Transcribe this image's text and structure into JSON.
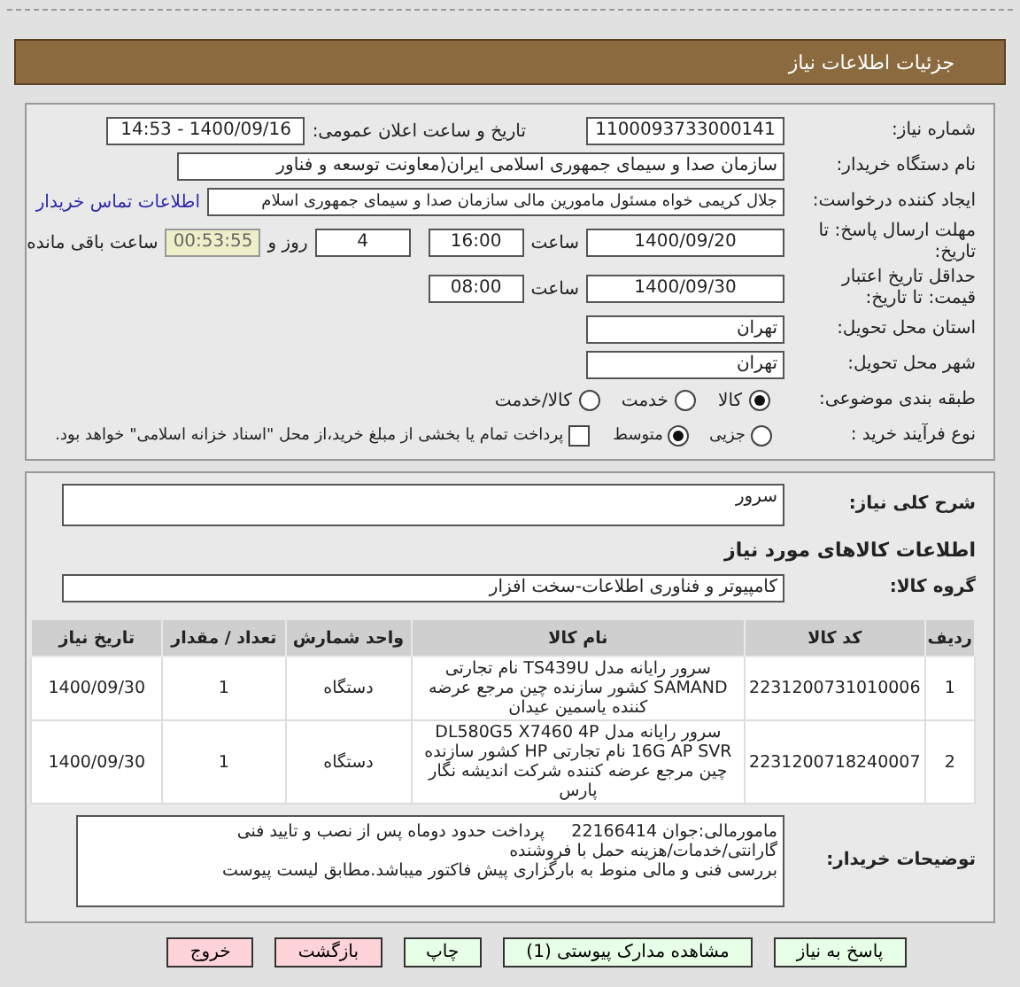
{
  "header": {
    "title": "جزئیات اطلاعات نیاز"
  },
  "need_number": {
    "label": "شماره نیاز:",
    "value": "1100093733000141"
  },
  "announce": {
    "label": "تاریخ و ساعت اعلان عمومی:",
    "value": "1400/09/16 - 14:53"
  },
  "buyer": {
    "label": "نام دستگاه خریدار:",
    "value": "سازمان صدا و سیمای جمهوری اسلامی ایران(معاونت توسعه و فناور"
  },
  "requester": {
    "label": "ایجاد کننده درخواست:",
    "value": "جلال کریمی خواه مسئول مامورین مالی  سازمان صدا و سیمای جمهوری اسلام",
    "link": "اطلاعات تماس خریدار"
  },
  "deadline": {
    "label": "مهلت ارسال پاسخ: تا تاریخ:",
    "date": "1400/09/20",
    "time_label": "ساعت",
    "time": "16:00",
    "days": "4",
    "days_label": "روز و",
    "remaining": "00:53:55",
    "remaining_label": "ساعت باقی مانده"
  },
  "validity": {
    "label": "حداقل تاریخ اعتبار قیمت: تا تاریخ:",
    "date": "1400/09/30",
    "time_label": "ساعت",
    "time": "08:00"
  },
  "province": {
    "label": "استان محل تحویل:",
    "value": "تهران"
  },
  "city": {
    "label": "شهر محل تحویل:",
    "value": "تهران"
  },
  "category": {
    "label": "طبقه بندی موضوعی:",
    "options": [
      {
        "label": "کالا",
        "selected": true
      },
      {
        "label": "خدمت",
        "selected": false
      },
      {
        "label": "کالا/خدمت",
        "selected": false
      }
    ]
  },
  "process": {
    "label": "نوع فرآیند خرید :",
    "options": [
      {
        "label": "جزیی",
        "selected": false
      },
      {
        "label": "متوسط",
        "selected": true
      }
    ],
    "treasury": {
      "label": "پرداخت تمام یا بخشی از مبلغ خرید،از محل \"اسناد خزانه اسلامی\" خواهد بود.",
      "checked": false
    }
  },
  "summary": {
    "label": "شرح کلی نیاز:",
    "value": "سرور"
  },
  "goods_heading": "اطلاعات کالاهای مورد نیاز",
  "goods_group": {
    "label": "گروه کالا:",
    "value": "کامپیوتر و فناوری اطلاعات-سخت افزار"
  },
  "table": {
    "columns": [
      "ردیف",
      "کد کالا",
      "نام کالا",
      "واحد شمارش",
      "تعداد / مقدار",
      "تاریخ نیاز"
    ],
    "rows": [
      [
        "1",
        "2231200731010006",
        "سرور رایانه مدل TS439U نام تجارتی SAMAND کشور سازنده چین مرجع عرضه کننده یاسمین عیدان",
        "دستگاه",
        "1",
        "1400/09/30"
      ],
      [
        "2",
        "2231200718240007",
        "سرور رایانه مدل DL580G5 X7460 4P 16G AP SVR نام تجارتی HP کشور سازنده چین مرجع عرضه کننده شرکت اندیشه نگار پارس",
        "دستگاه",
        "1",
        "1400/09/30"
      ]
    ]
  },
  "buyer_notes": {
    "label": "توضیحات خریدار:",
    "lines": [
      "مامورمالی:جوان 22166414     پرداخت حدود دوماه پس از نصب و تایید فنی",
      "گارانتی/خدمات/هزینه حمل با فروشنده",
      "بررسی فنی و مالی منوط به بارگزاری پیش فاکتور میباشد.مطابق لیست پیوست"
    ]
  },
  "buttons": [
    {
      "label": "پاسخ به نیاز",
      "kind": "action"
    },
    {
      "label": "مشاهده مدارک پیوستی (1)",
      "kind": "action"
    },
    {
      "label": "چاپ",
      "kind": "action"
    },
    {
      "label": "بازگشت",
      "kind": "exit"
    },
    {
      "label": "خروج",
      "kind": "exit"
    }
  ]
}
